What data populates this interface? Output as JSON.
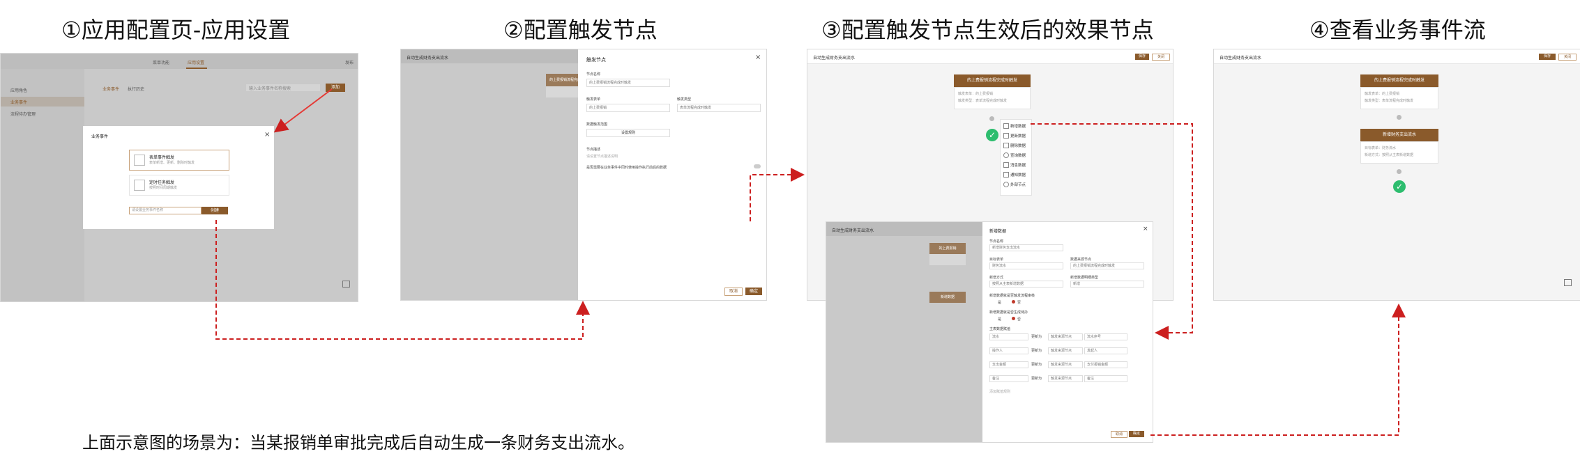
{
  "titles": {
    "step1": "①应用配置页-应用设置",
    "step2": "②配置触发节点",
    "step3": "③配置触发节点生效后的效果节点",
    "step4": "④查看业务事件流"
  },
  "caption": "上面示意图的场景为：当某报销单审批完成后自动生成一条财务支出流水。",
  "panel1": {
    "top_tabs": [
      "菜单功能",
      "应用设置"
    ],
    "top_right": "发布",
    "sidebar": [
      "应用角色",
      "业务事件",
      "流程待办管理"
    ],
    "subtabs": [
      "业务事件",
      "执行历史"
    ],
    "search_placeholder": "输入业务事件名称搜索",
    "add_btn": "添加",
    "dialog_title": "业务事件",
    "option1_title": "表单事件触发",
    "option1_desc": "表单新增、更新、删除时触发",
    "option2_title": "定时任务触发",
    "option2_desc": "按照时间周期触发",
    "name_placeholder": "请设置业务事件名称",
    "create_btn": "创建"
  },
  "panel2": {
    "header": "自动生成财务支出流水",
    "bg_node": "的上费报销流程完成时触发",
    "drawer_title": "触发节点",
    "label_name": "节点名称",
    "value_name": "的上费报销流程完成时触发",
    "label_form": "触发表单",
    "value_form": "的上费报销",
    "label_type": "触发类型",
    "value_type": "表单流程完成时触发",
    "label_range": "数据触发范围",
    "range_btn": "设置规则",
    "label_desc": "节点描述",
    "desc_placeholder": "请设置节点描述说明",
    "switch_label": "是否需要在业务事件中同时使用操作执行前后的数据",
    "cancel": "取消",
    "confirm": "确定"
  },
  "panel3": {
    "header": "自动生成财务支出流水",
    "btn_save": "保存",
    "btn_close": "关闭",
    "node_title": "的上费报销流程完成时触发",
    "node_line1": "触发表单：的上费报销",
    "node_line2": "触发类型：表单流程完成时触发",
    "menu": [
      "新增数据",
      "更新数据",
      "删除数据",
      "查询数据",
      "消息数据",
      "通知数据",
      "外部节点"
    ],
    "drawer_title": "新增数据",
    "label_name": "节点名称",
    "value_name": "新增财务支出流水",
    "label_form": "目标表单",
    "value_form": "财务流水",
    "label_src": "数据来源节点",
    "value_src": "的上费报销流程完成时触发",
    "label_mode": "新增方式",
    "value_mode": "按照从主表新增数据",
    "label_dest": "新增数据明细类型",
    "value_dest": "新增",
    "q1": "新增数据就是否触发流程审核",
    "q2": "新增数据就是否生成待办",
    "yes": "是",
    "no": "否",
    "rules_label": "主表数据赋值",
    "rows": [
      {
        "f": "流水",
        "op": "更新为",
        "src": "触发来源节点",
        "v": "流水序号"
      },
      {
        "f": "操作人",
        "op": "更新为",
        "src": "触发来源节点",
        "v": "发起人"
      },
      {
        "f": "支出金额",
        "op": "更新为",
        "src": "触发来源节点",
        "v": "支付报销金额"
      },
      {
        "f": "备注",
        "op": "更新为",
        "src": "触发来源节点",
        "v": "备注"
      }
    ],
    "add_rule": "添加赋值规则",
    "cancel": "取消",
    "confirm": "确定",
    "bg_node_small": "的上费报销",
    "bg_node_small2": "新增数据"
  },
  "panel4": {
    "header": "自动生成财务支出流水",
    "btn_save": "保存",
    "btn_close": "关闭",
    "node1_title": "的上费报销流程完成时触发",
    "node1_l1": "触发表单：的上费报销",
    "node1_l2": "触发类型：表单流程完成时触发",
    "node2_title": "新增财务支出流水",
    "node2_l1": "目标表单：财务流水",
    "node2_l2": "新增方式：按照从主表新增数据"
  },
  "colors": {
    "brand": "#8a5a2b",
    "arrow": "#cc1f1f",
    "success": "#2dbd6e"
  }
}
